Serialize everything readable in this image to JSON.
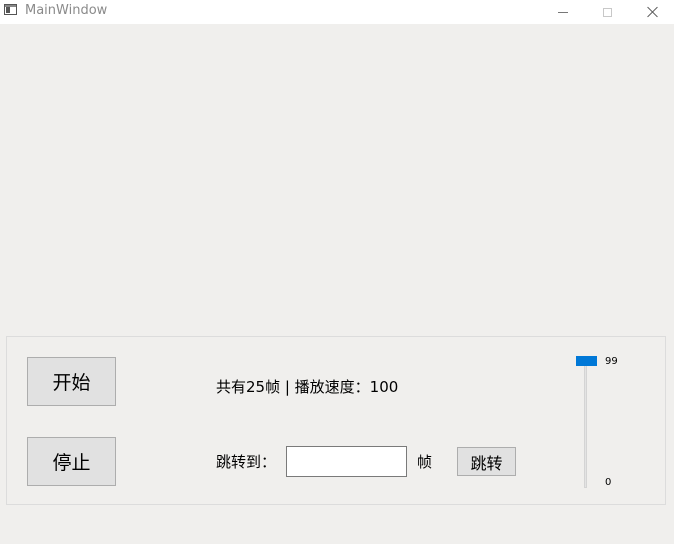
{
  "window": {
    "title": "MainWindow"
  },
  "controls": {
    "start_label": "开始",
    "stop_label": "停止",
    "info_text": "共有25帧  | 播放速度：100",
    "jump_to_label": "跳转到：",
    "frame_input_value": "",
    "frame_unit_label": "帧",
    "jump_button_label": "跳转"
  },
  "speed_slider": {
    "max_label": "99",
    "min_label": "0",
    "value": 99,
    "min": 0,
    "max": 99
  },
  "colors": {
    "accent": "#0078d7",
    "button_bg": "#e1e1e1",
    "window_bg": "#f0efed"
  }
}
